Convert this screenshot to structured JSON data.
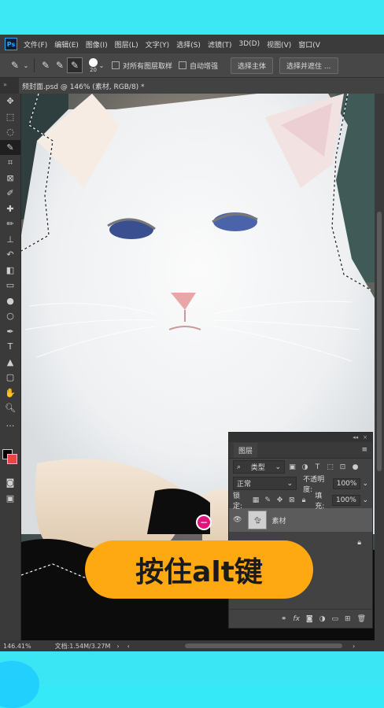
{
  "app": {
    "logo": "Ps",
    "menu": [
      "文件(F)",
      "编辑(E)",
      "图像(I)",
      "图层(L)",
      "文字(Y)",
      "选择(S)",
      "滤镜(T)",
      "3D(D)",
      "视图(V)",
      "窗口(V"
    ]
  },
  "options": {
    "brush_size": "20",
    "sample_all_layers": "对所有图层取样",
    "auto_enhance": "自动增强",
    "select_subject": "选择主体",
    "select_and_mask": "选择并遮住 ..."
  },
  "document": {
    "tab_title": "频封面.psd @ 146% (素材, RGB/8) *"
  },
  "status": {
    "zoom": "146.41%",
    "doc_info": "文档:1.54M/3.27M"
  },
  "layers_panel": {
    "title": "图层",
    "filter_kind": "类型",
    "blend_mode": "正常",
    "opacity_label": "不透明度:",
    "opacity_value": "100%",
    "lock_label": "锁定:",
    "fill_label": "填充:",
    "fill_value": "100%",
    "layers": [
      {
        "name": "素材"
      }
    ]
  },
  "overlay": {
    "caption": "按住alt键",
    "cursor_symbol": "−"
  }
}
